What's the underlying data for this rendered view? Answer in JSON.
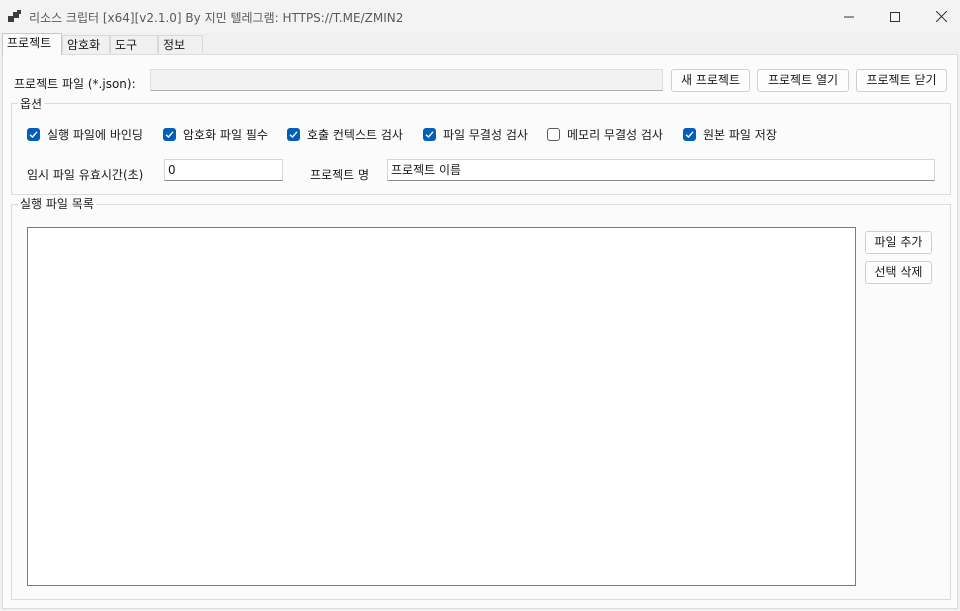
{
  "window": {
    "title": "리소스 크립터 [x64][v2.1.0] By 지민 텔레그램: HTTPS://T.ME/ZMIN2",
    "controls": {
      "minimize_icon": "minimize-icon",
      "maximize_icon": "maximize-icon",
      "close_icon": "close-icon"
    }
  },
  "tabs": [
    {
      "label": "프로젝트",
      "active": true
    },
    {
      "label": "암호화",
      "active": false
    },
    {
      "label": "도구",
      "active": false
    },
    {
      "label": "정보",
      "active": false
    }
  ],
  "project": {
    "file_label": "프로젝트 파일 (*.json):",
    "file_value": "",
    "new_button": "새 프로젝트",
    "open_button": "프로젝트 열기",
    "close_button": "프로젝트 닫기"
  },
  "options": {
    "group_title": "옵션",
    "checkboxes": [
      {
        "label": "실행 파일에 바인딩",
        "checked": true
      },
      {
        "label": "암호화 파일 필수",
        "checked": true
      },
      {
        "label": "호출 컨텍스트 검사",
        "checked": true
      },
      {
        "label": "파일 무결성 검사",
        "checked": true
      },
      {
        "label": "메모리 무결성 검사",
        "checked": false
      },
      {
        "label": "원본 파일 저장",
        "checked": true
      }
    ],
    "temp_file_label": "임시 파일 유효시간(초)",
    "temp_file_value": "0",
    "project_name_label": "프로젝트 명",
    "project_name_value": "프로젝트 이름"
  },
  "files": {
    "group_title": "실행 파일 목록",
    "items": [],
    "add_button": "파일 추가",
    "remove_button": "선택 삭제"
  },
  "colors": {
    "accent": "#005fb8",
    "window_bg": "#f0f0f0",
    "panel_bg": "#fbfbfb"
  }
}
